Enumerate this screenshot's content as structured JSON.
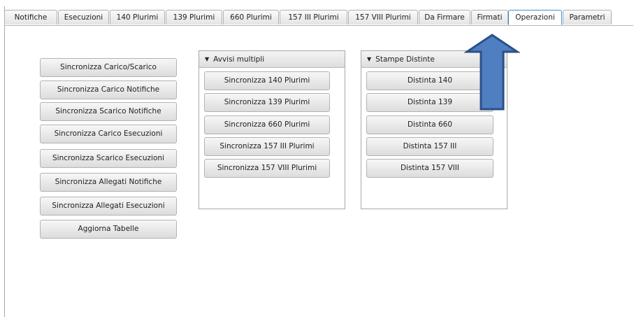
{
  "tabs": [
    {
      "label": "Notifiche",
      "selected": false
    },
    {
      "label": "Esecuzioni",
      "selected": false
    },
    {
      "label": "140 Plurimi",
      "selected": false
    },
    {
      "label": "139 Plurimi",
      "selected": false
    },
    {
      "label": "660 Plurimi",
      "selected": false
    },
    {
      "label": "157 III Plurimi",
      "selected": false
    },
    {
      "label": "157 VIII Plurimi",
      "selected": false
    },
    {
      "label": "Da Firmare",
      "selected": false
    },
    {
      "label": "Firmati",
      "selected": false
    },
    {
      "label": "Operazioni",
      "selected": true
    },
    {
      "label": "Parametri",
      "selected": false
    }
  ],
  "sync_buttons": [
    "Sincronizza Carico/Scarico",
    "Sincronizza Carico Notifiche",
    "Sincronizza Scarico Notifiche",
    "Sincronizza Carico Esecuzioni",
    "Sincronizza Scarico Esecuzioni",
    "Sincronizza Allegati Notifiche",
    "Sincronizza Allegati Esecuzioni",
    "Aggiorna Tabelle"
  ],
  "avvisi_panel": {
    "title": "Avvisi multipli",
    "buttons": [
      "Sincronizza 140 Plurimi",
      "Sincronizza 139 Plurimi",
      "Sincronizza 660 Plurimi",
      "Sincronizza 157 III Plurimi",
      "Sincronizza 157 VIII Plurimi"
    ]
  },
  "stampe_panel": {
    "title": "Stampe Distinte",
    "buttons": [
      "Distinta 140",
      "Distinta 139",
      "Distinta 660",
      "Distinta 157 III",
      "Distinta 157 VIII"
    ]
  },
  "icons": {
    "collapse": "triangle-down-icon",
    "annotation": "arrow-up-icon"
  },
  "colors": {
    "selected_tab_border": "#3c8fd6",
    "arrow_fill": "#4f7fc0",
    "arrow_stroke": "#2a4f8a"
  }
}
